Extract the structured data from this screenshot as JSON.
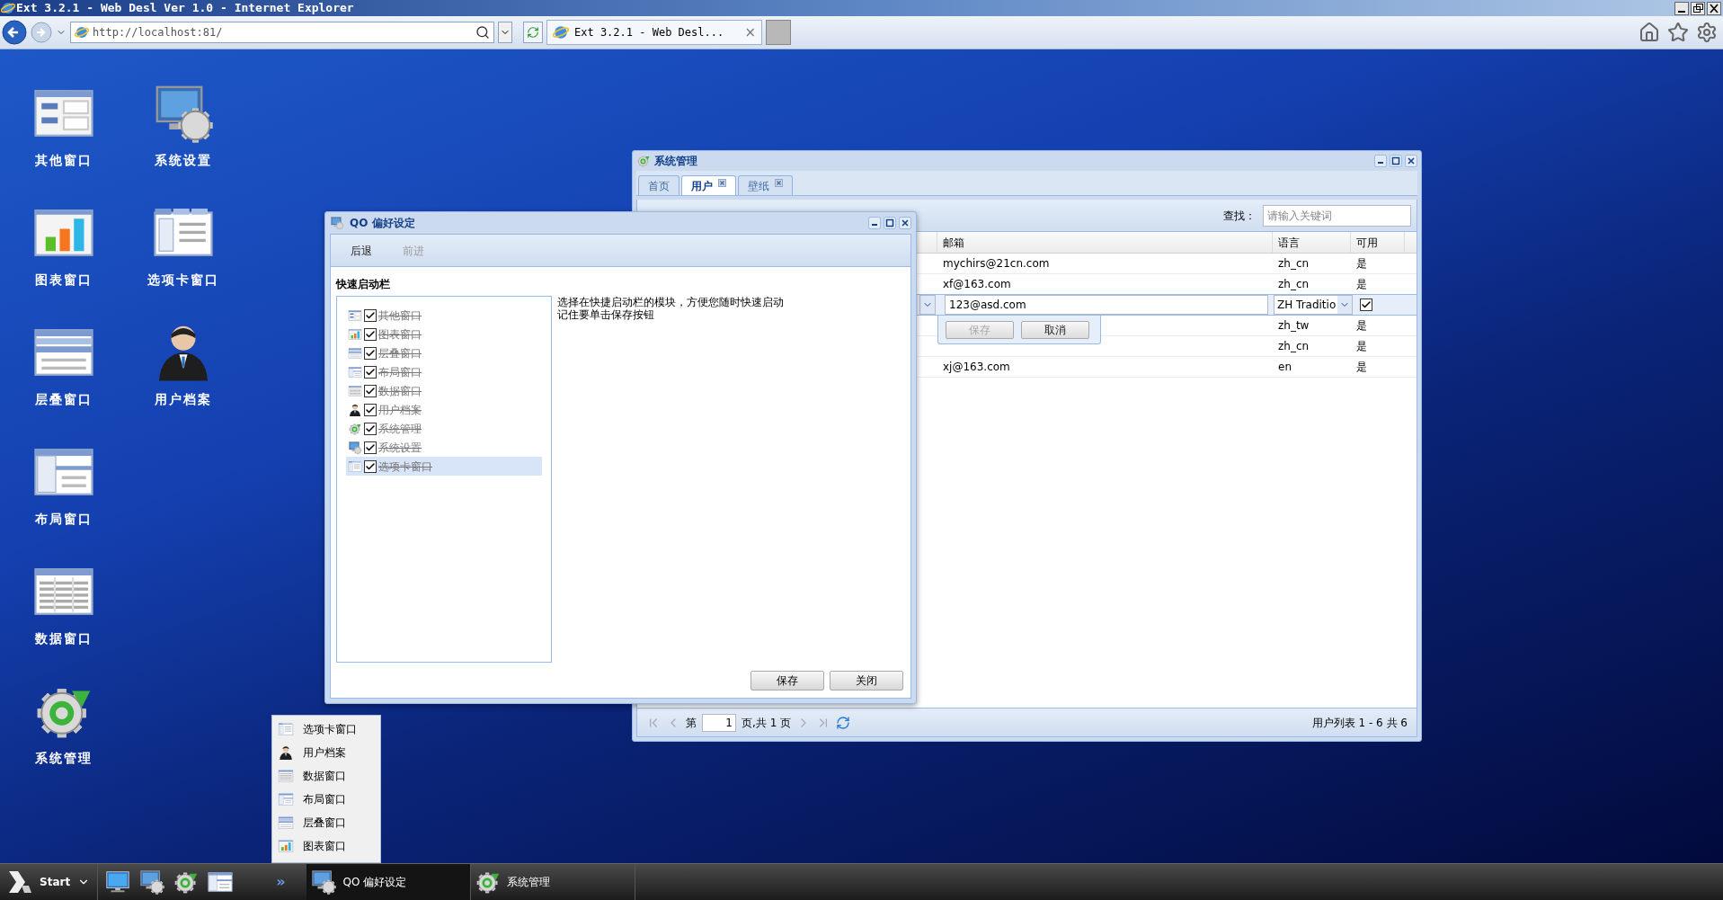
{
  "browser": {
    "title": "Ext 3.2.1 - Web Desl Ver 1.0 - Internet Explorer",
    "address": "http://localhost:81/",
    "tab": "Ext 3.2.1 - Web Desl...",
    "tab_close": "×"
  },
  "desktop_columns": [
    [
      {
        "label": "其他窗口",
        "kind": "other"
      },
      {
        "label": "图表窗口",
        "kind": "chart"
      },
      {
        "label": "层叠窗口",
        "kind": "cascade"
      },
      {
        "label": "布局窗口",
        "kind": "layout"
      },
      {
        "label": "数据窗口",
        "kind": "grid"
      },
      {
        "label": "系统管理",
        "kind": "sysadmin"
      }
    ],
    [
      {
        "label": "系统设置",
        "kind": "settings"
      },
      {
        "label": "选项卡窗口",
        "kind": "tabs"
      },
      {
        "label": "用户档案",
        "kind": "user"
      }
    ]
  ],
  "admin_window": {
    "title": "系统管理",
    "tabs": [
      {
        "label": "首页",
        "selected": false,
        "closable": false
      },
      {
        "label": "用户",
        "selected": true,
        "closable": true
      },
      {
        "label": "壁纸",
        "selected": false,
        "closable": true
      }
    ],
    "search_label": "查找：",
    "search_placeholder": "请输入关键词",
    "columns": [
      "邮箱",
      "语言",
      "可用"
    ],
    "rows": [
      {
        "email": "mychirs@21cn.com",
        "lang": "zh_cn",
        "enabled": "是",
        "editing": false
      },
      {
        "email": "xf@163.com",
        "lang": "zh_cn",
        "enabled": "是",
        "editing": false
      },
      {
        "email": "123@asd.com",
        "lang": "ZH Traditio",
        "checked": true,
        "editing": true
      },
      {
        "lang": "zh_tw",
        "enabled": "是",
        "editing": false
      },
      {
        "lang": "zh_cn",
        "enabled": "是",
        "editing": false
      },
      {
        "email": "xj@163.com",
        "lang": "en",
        "enabled": "是",
        "editing": false
      }
    ],
    "editor_buttons": [
      {
        "label": "保存",
        "disabled": true
      },
      {
        "label": "取消",
        "disabled": false
      }
    ],
    "pager": {
      "prefix": "第",
      "page": "1",
      "suffix": "页,共 1 页",
      "summary": "用户列表 1 - 6 共 6"
    }
  },
  "qo_window": {
    "title": "QO 偏好设定",
    "toolbar": [
      {
        "label": "后退",
        "disabled": false
      },
      {
        "label": "前进",
        "disabled": true
      }
    ],
    "section": "快速启动栏",
    "items": [
      {
        "label": "其他窗口",
        "kind": "other",
        "checked": true,
        "selected": false
      },
      {
        "label": "图表窗口",
        "kind": "chart",
        "checked": true,
        "selected": false
      },
      {
        "label": "层叠窗口",
        "kind": "cascade",
        "checked": true,
        "selected": false
      },
      {
        "label": "布局窗口",
        "kind": "layout",
        "checked": true,
        "selected": false
      },
      {
        "label": "数据窗口",
        "kind": "grid",
        "checked": true,
        "selected": false
      },
      {
        "label": "用户档案",
        "kind": "user",
        "checked": true,
        "selected": false
      },
      {
        "label": "系统管理",
        "kind": "sysadmin",
        "checked": true,
        "selected": false
      },
      {
        "label": "系统设置",
        "kind": "settings",
        "checked": true,
        "selected": false
      },
      {
        "label": "选项卡窗口",
        "kind": "tabs",
        "checked": true,
        "selected": true
      }
    ],
    "description": [
      "选择在快捷启动栏的模块，方便您随时快速启动",
      "记住要单击保存按钮"
    ],
    "buttons": [
      "保存",
      "关闭"
    ]
  },
  "quick_menu": [
    {
      "label": "选项卡窗口",
      "kind": "tabs"
    },
    {
      "label": "用户档案",
      "kind": "user"
    },
    {
      "label": "数据窗口",
      "kind": "grid"
    },
    {
      "label": "布局窗口",
      "kind": "layout"
    },
    {
      "label": "层叠窗口",
      "kind": "cascade"
    },
    {
      "label": "图表窗口",
      "kind": "chart"
    }
  ],
  "taskbar": {
    "start": "Start",
    "quick_launch": [
      {
        "kind": "monitor"
      },
      {
        "kind": "settings"
      },
      {
        "kind": "sysadmin"
      },
      {
        "kind": "layout"
      }
    ],
    "overflow": "»",
    "tasks": [
      {
        "label": "QO 偏好设定",
        "kind": "settings",
        "selected": true
      },
      {
        "label": "系统管理",
        "kind": "sysadmin",
        "selected": false
      }
    ]
  }
}
